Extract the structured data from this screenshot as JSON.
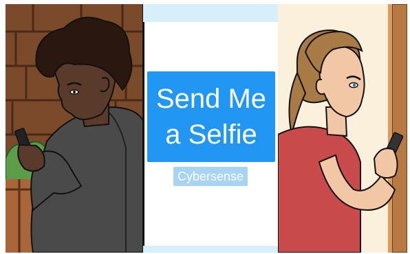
{
  "title": {
    "line1": "Send Me",
    "line2": "a Selfie"
  },
  "badge": "Cybersense",
  "colors": {
    "title_box": "#2196f3",
    "badge_box": "#a9d3f5",
    "side_bars": "#d7eefb",
    "divider": "#111111"
  },
  "illustrations": {
    "left": "boy-texting-on-phone",
    "right": "woman-texting-on-phone"
  }
}
